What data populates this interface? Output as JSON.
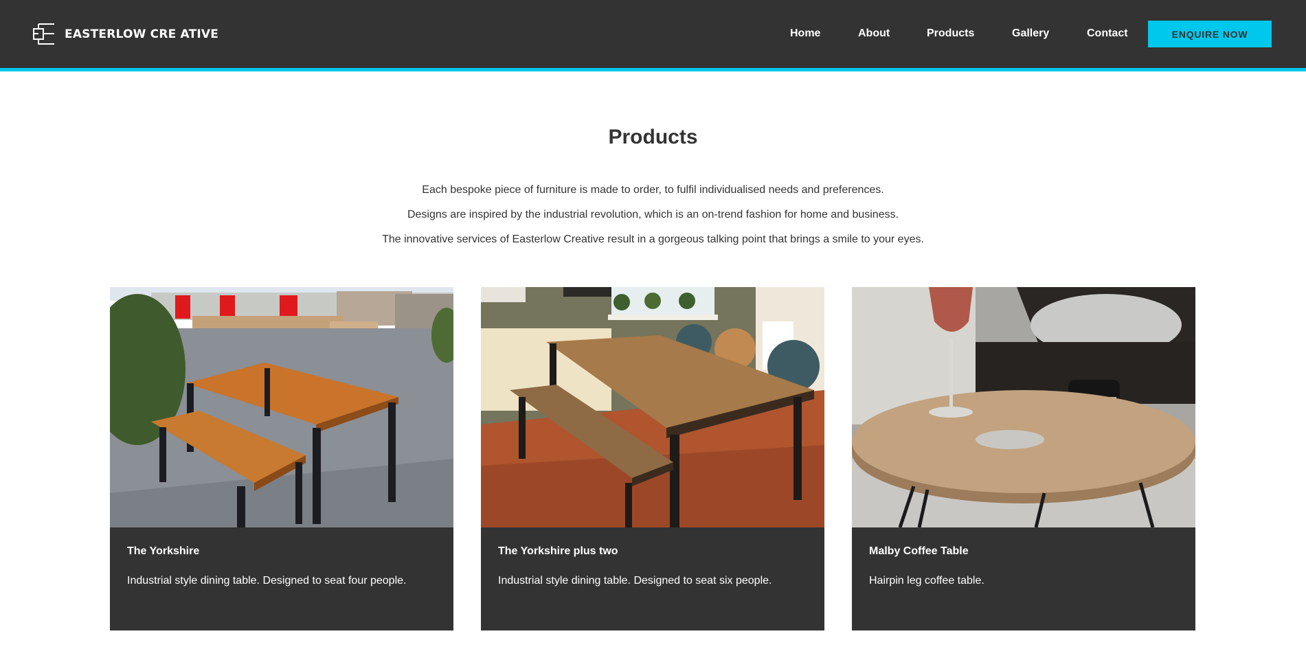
{
  "header": {
    "logo_text": "EASTERLOW CRE ATIVE",
    "nav": [
      "Home",
      "About",
      "Products",
      "Gallery",
      "Contact"
    ],
    "cta_label": "ENQUIRE NOW"
  },
  "main": {
    "title": "Products",
    "intro": [
      "Each bespoke piece of furniture is made to order, to fulfil individualised needs and preferences.",
      "Designs are inspired by the industrial revolution, which is an on-trend fashion for home and business.",
      "The innovative services of Easterlow Creative result in a gorgeous talking point that brings a smile to your eyes."
    ]
  },
  "products": [
    {
      "title": "The Yorkshire",
      "description": "Industrial style dining table. Designed to seat four people."
    },
    {
      "title": "The Yorkshire plus two",
      "description": "Industrial style dining table. Designed to seat six people."
    },
    {
      "title": "Malby Coffee Table",
      "description": "Hairpin leg coffee table."
    }
  ],
  "colors": {
    "header_bg": "#333333",
    "accent": "#00c8ec",
    "card_bg": "#333333",
    "text": "#333333"
  },
  "icons": {
    "logo": "easterlow-monogram-icon"
  }
}
